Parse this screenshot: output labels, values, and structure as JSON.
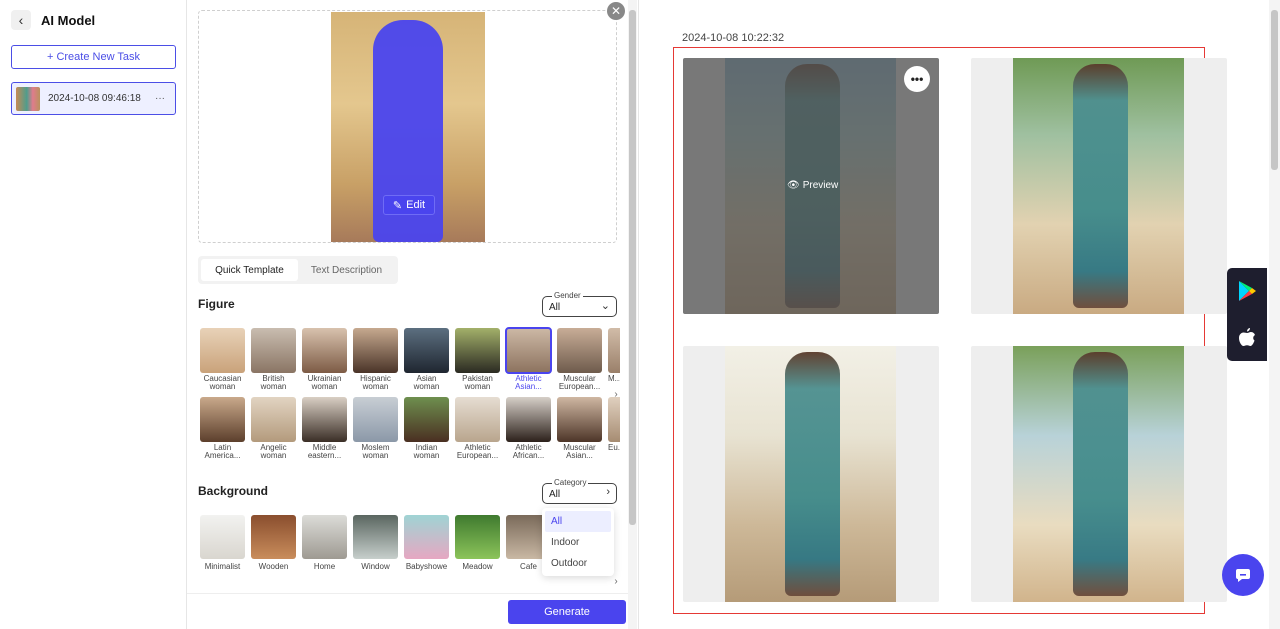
{
  "sidebar": {
    "title": "AI Model",
    "create_label": "+ Create New Task",
    "task": {
      "date": "2024-10-08 09:46:18",
      "more": "···"
    }
  },
  "editor": {
    "edit_label": "Edit",
    "tabs": [
      {
        "label": "Quick Template",
        "active": true
      },
      {
        "label": "Text Description",
        "active": false
      }
    ],
    "figure": {
      "title": "Figure",
      "gender_legend": "Gender",
      "gender_value": "All",
      "row1": [
        {
          "label": "Caucasian\nwoman"
        },
        {
          "label": "British\nwoman"
        },
        {
          "label": "Ukrainian\nwoman"
        },
        {
          "label": "Hispanic\nwoman"
        },
        {
          "label": "Asian\nwoman"
        },
        {
          "label": "Pakistan\nwoman"
        },
        {
          "label": "Athletic\nAsian...",
          "selected": true
        },
        {
          "label": "Muscular\nEuropean..."
        },
        {
          "label": "M..."
        }
      ],
      "row2": [
        {
          "label": "Latin\nAmerica..."
        },
        {
          "label": "Angelic\nwoman"
        },
        {
          "label": "Middle\neastern..."
        },
        {
          "label": "Moslem\nwoman"
        },
        {
          "label": "Indian\nwoman"
        },
        {
          "label": "Athletic\nEuropean..."
        },
        {
          "label": "Athletic\nAfrican..."
        },
        {
          "label": "Muscular\nAsian..."
        },
        {
          "label": "Eu..."
        }
      ]
    },
    "background": {
      "title": "Background",
      "category_legend": "Category",
      "category_value": "All",
      "items": [
        "Minimalist",
        "Wooden",
        "Home",
        "Window",
        "Babyshowe",
        "Meadow",
        "Cafe"
      ],
      "dropdown": [
        {
          "label": "All",
          "selected": true
        },
        {
          "label": "Indoor"
        },
        {
          "label": "Outdoor"
        }
      ]
    },
    "generate_label": "Generate"
  },
  "results": {
    "date": "2024-10-08 10:22:32",
    "preview_label": "Preview",
    "more": "•••"
  },
  "colors": {
    "accent": "#4a44ee",
    "result_border": "#e53935",
    "store_bar": "#1e1e2e"
  }
}
